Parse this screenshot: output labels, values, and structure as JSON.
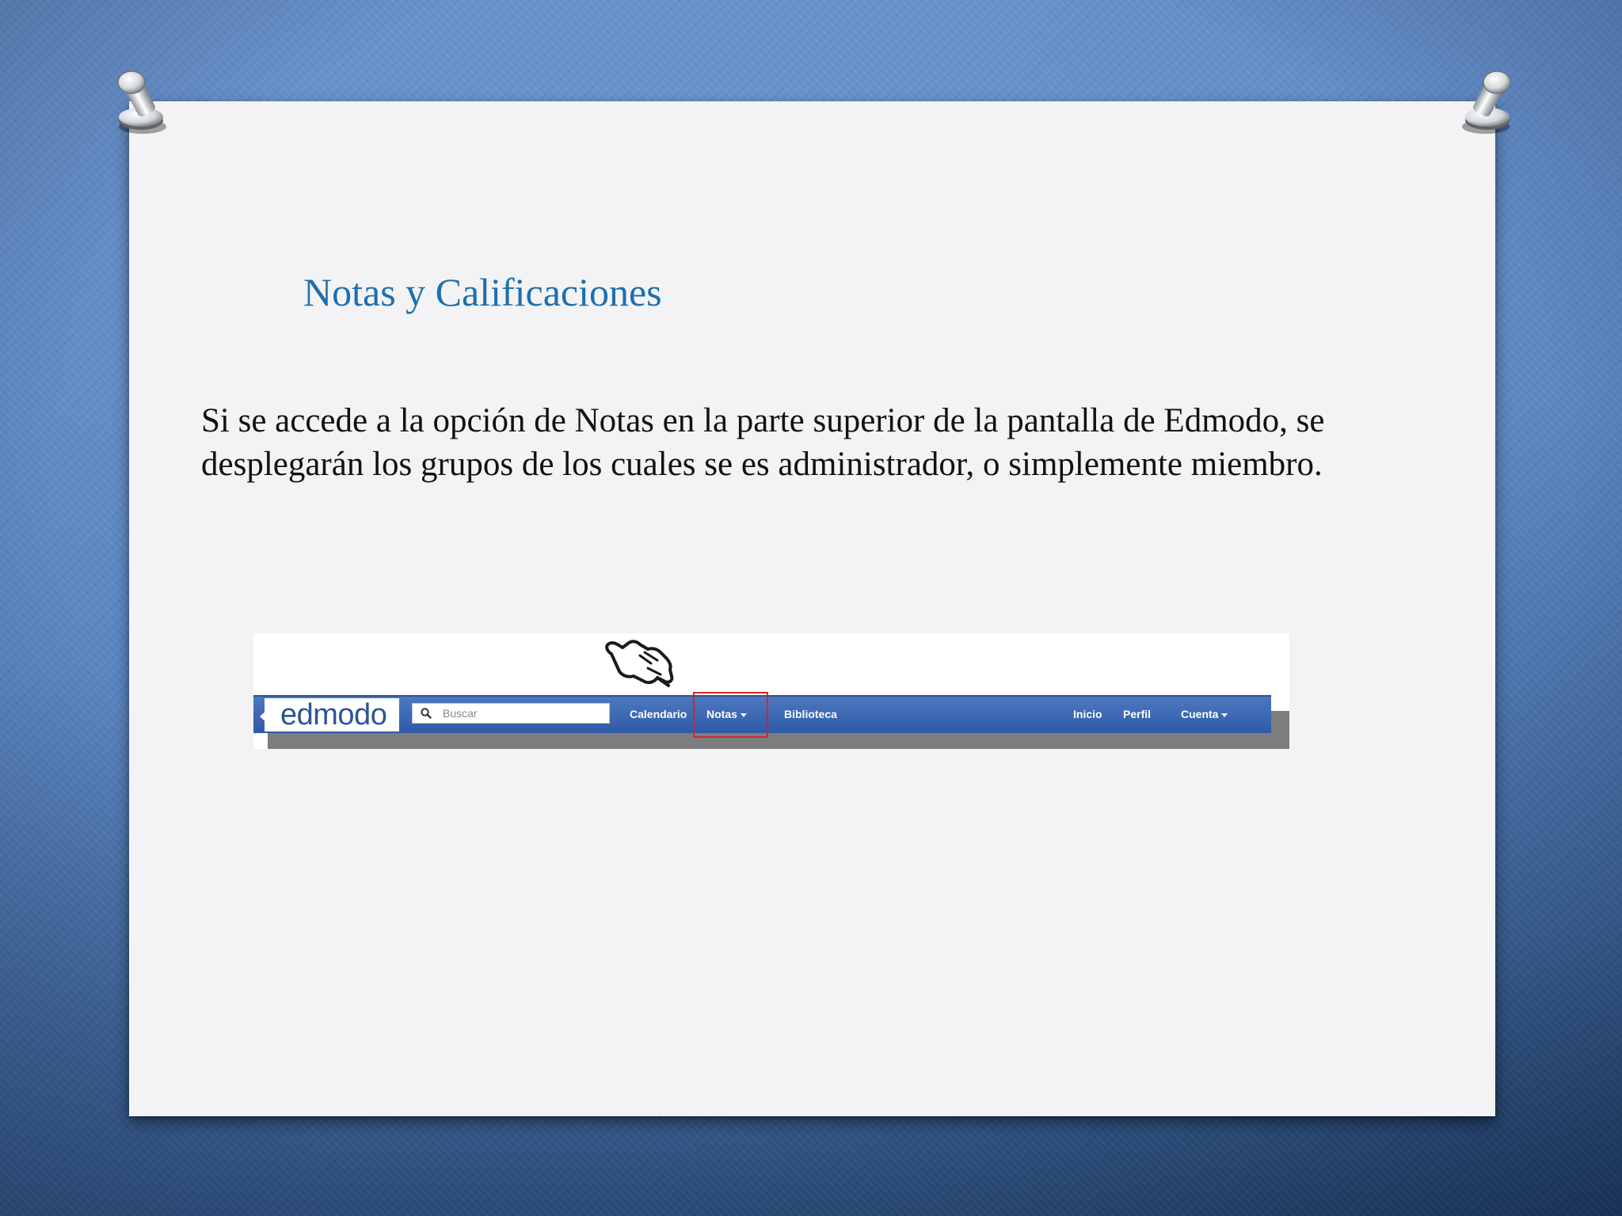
{
  "slide": {
    "title": "Notas y Calificaciones",
    "body": "Si se accede a la opción de Notas en la parte superior de la pantalla de Edmodo, se desplegarán los grupos de los cuales se es administrador, o simplemente miembro."
  },
  "screenshot": {
    "logo": "edmodo",
    "search_placeholder": "Buscar",
    "nav_left": [
      "Calendario",
      "Notas",
      "Biblioteca"
    ],
    "nav_right": [
      "Inicio",
      "Perfil",
      "Cuenta"
    ],
    "highlighted_item": "Notas",
    "icons": [
      "pointing-hand-icon",
      "search-icon",
      "caret-down-icon"
    ]
  },
  "colors": {
    "title": "#1e6fae",
    "navbar": "#3a64ae",
    "highlight": "#d6242a",
    "background": "#5b86c2"
  }
}
